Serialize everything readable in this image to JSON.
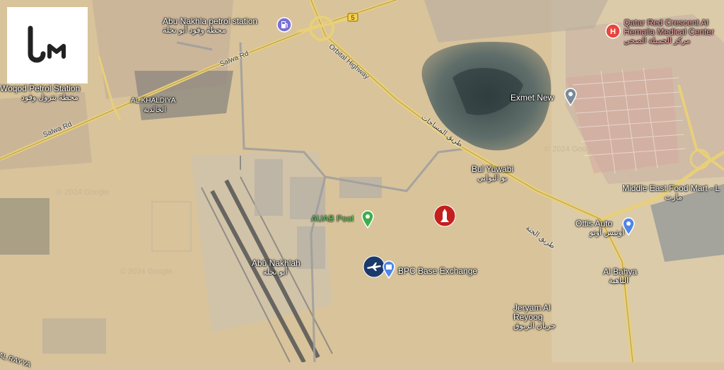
{
  "logo": {
    "text": "UM",
    "icon": "brand-logo-icon"
  },
  "roads": {
    "salwa_rd_1": "Salwa Rd",
    "salwa_rd_2": "Salwa Rd",
    "orbital_highway": "Orbital Highway",
    "orbital_highway_ar": "طريق المساحات",
    "route_number": "5",
    "jeryan_road_ar": "طريق الجنة"
  },
  "places": [
    {
      "id": "abu-nakhla-petrol",
      "name": "Abu Nakhla petrol station",
      "name_ar": "محطة وقود أبو نخلة",
      "icon": "fuel-pump-icon",
      "color": "#7b6fd6"
    },
    {
      "id": "woqod-petrol",
      "name": "Woqod Petrol Station",
      "name_ar": "محطة بترول وقود"
    },
    {
      "id": "al-khaldiya",
      "name": "AL KHALDIYA",
      "name_ar": "الخالدية"
    },
    {
      "id": "qatar-red-crescent",
      "name": "Qatar Red Crescent Al Hemaila Medical Center",
      "name_ar": "مركز الحميلة الصحي",
      "icon": "hospital-icon",
      "color": "#e8453c"
    },
    {
      "id": "exmet-new",
      "name": "Exmet New",
      "icon": "pin-icon",
      "color": "#7a8a99"
    },
    {
      "id": "bul-yuwabi",
      "name": "Bul Yuwabi",
      "name_ar": "بو اليوابي"
    },
    {
      "id": "middle-east-food-mart",
      "name": "Middle East Food Mart - L",
      "name_ar": "مارت"
    },
    {
      "id": "ottis-auto",
      "name": "Ottis Auto",
      "name_ar": "أوتيس أوتو",
      "icon": "pin-icon",
      "color": "#4f86e6"
    },
    {
      "id": "auab-pool",
      "name": "AUAB Pool",
      "icon": "pin-icon",
      "color": "#3fae49"
    },
    {
      "id": "abu-nakhlah",
      "name": "Abū Nakhlah",
      "name_ar": "أبو نخلة"
    },
    {
      "id": "bpc-base-exchange",
      "name": "BPC Base Exchange",
      "icon": "shopping-bag-icon",
      "color": "#4f86e6"
    },
    {
      "id": "al-bahya",
      "name": "Al Bahya",
      "name_ar": "الباهية"
    },
    {
      "id": "jeryam-al-reyoog",
      "name": "Jeryam Al Reyoog",
      "name_ar": "جريان الريوق"
    },
    {
      "id": "al-rayyan",
      "name": "AL RAYYA"
    }
  ],
  "markers": {
    "missile": {
      "icon": "missile-icon",
      "color": "#c41e1e"
    },
    "aircraft": {
      "icon": "aircraft-icon",
      "color": "#1b3a6b"
    }
  },
  "watermarks": [
    "© 2024 Google",
    "© 2024 Google",
    "© 2024 Google"
  ]
}
